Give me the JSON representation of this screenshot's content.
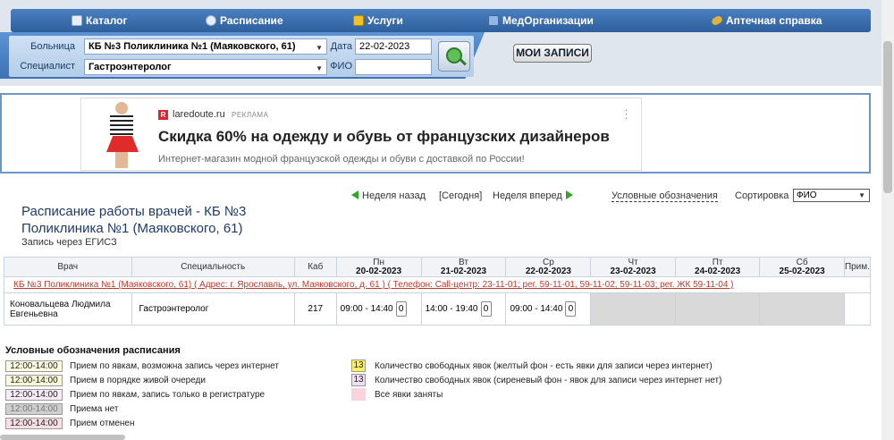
{
  "nav": {
    "items": [
      {
        "label": "Каталог",
        "icon": "catalog-icon"
      },
      {
        "label": "Расписание",
        "icon": "clock-icon"
      },
      {
        "label": "Услуги",
        "icon": "money-icon"
      },
      {
        "label": "МедОрганизации",
        "icon": "book-icon"
      },
      {
        "label": "Аптечная справка",
        "icon": "pill-icon"
      }
    ]
  },
  "search": {
    "hospital_label": "Больница",
    "hospital_value": "КБ №3 Поликлиника №1 (Маяковского, 61)",
    "specialist_label": "Специалист",
    "specialist_value": "Гастроэнтеролог",
    "date_label": "Дата",
    "date_value": "22-02-2023",
    "fio_label": "ФИО",
    "fio_value": "",
    "my_records_label": "МОИ ЗАПИСИ"
  },
  "ad": {
    "domain": "laredoute.ru",
    "tag": "РЕКЛАМА",
    "title": "Скидка 60% на одежду и обувь от французских дизайнеров",
    "subtitle": "Интернет-магазин модной французской одежды и обуви с доставкой по России!",
    "logo_letter": "R"
  },
  "schedule": {
    "title": "Расписание работы врачей - КБ №3 Поликлиника №1 (Маяковского, 61)",
    "subtitle": "Запись через ЕГИСЗ",
    "week_back": "Неделя назад",
    "today": "[Сегодня]",
    "week_forward": "Неделя вперед",
    "legend_link": "Условные обозначения",
    "sort_label": "Сортировка",
    "sort_value": "ФИО"
  },
  "table": {
    "headers": {
      "doctor": "Врач",
      "specialty": "Специальность",
      "cab": "Каб",
      "note": "Прим."
    },
    "days": [
      {
        "day": "Пн",
        "date": "20-02-2023"
      },
      {
        "day": "Вт",
        "date": "21-02-2023"
      },
      {
        "day": "Ср",
        "date": "22-02-2023"
      },
      {
        "day": "Чт",
        "date": "23-02-2023"
      },
      {
        "day": "Пт",
        "date": "24-02-2023"
      },
      {
        "day": "Сб",
        "date": "25-02-2023"
      }
    ],
    "org_row": "КБ №3 Поликлиника №1 (Маяковского, 61) ( Адрес: г. Ярославль, ул. Маяковского, д. 61 ) ( Телефон: Call-центр: 23-11-01; рег. 59-11-01, 59-11-02, 59-11-03; рег. ЖК 59-11-04 )",
    "doctor": {
      "name": "Коновальцева Людмила Евгеньевна",
      "specialty": "Гастроэнтеролог",
      "cab": "217",
      "slots": [
        {
          "time": "09:00 - 14:40",
          "count": "0"
        },
        {
          "time": "14:00 - 19:40",
          "count": "0"
        },
        {
          "time": "09:00 - 14:40",
          "count": "0"
        }
      ]
    }
  },
  "legend": {
    "title": "Условные обозначения расписания",
    "left": [
      {
        "box": "12:00-14:00",
        "text": "Прием по явкам, возможна запись через интернет",
        "bg": "#fffde0"
      },
      {
        "box": "12:00-14:00",
        "text": "Прием в порядке живой очереди",
        "bg": "#fdf9d8"
      },
      {
        "box": "12:00-14:00",
        "text": "Прием по явкам, запись только в регистратуре",
        "bg": "#f7ecf5"
      },
      {
        "box": "12:00-14:00",
        "text": "Приема нет",
        "bg": "#cfcfcf"
      },
      {
        "box": "12:00-14:00",
        "text": "Прием отменен",
        "bg": "#f9dfe4"
      }
    ],
    "right": [
      {
        "box": "13",
        "text": "Количество свободных явок (желтый фон - есть явки для записи через интернет)",
        "bg": "#fff35c"
      },
      {
        "box": "13",
        "text": "Количество свободных явок (сиреневый фон - явок для записи через интернет нет)",
        "bg": "#f0def2"
      },
      {
        "box": "",
        "text": "Все явки заняты",
        "bg": "#f8d4dc"
      }
    ]
  },
  "colors": {
    "nav_bg": "#3a6cab",
    "link_red": "#c0392b",
    "title_blue": "#1f3a6b"
  }
}
